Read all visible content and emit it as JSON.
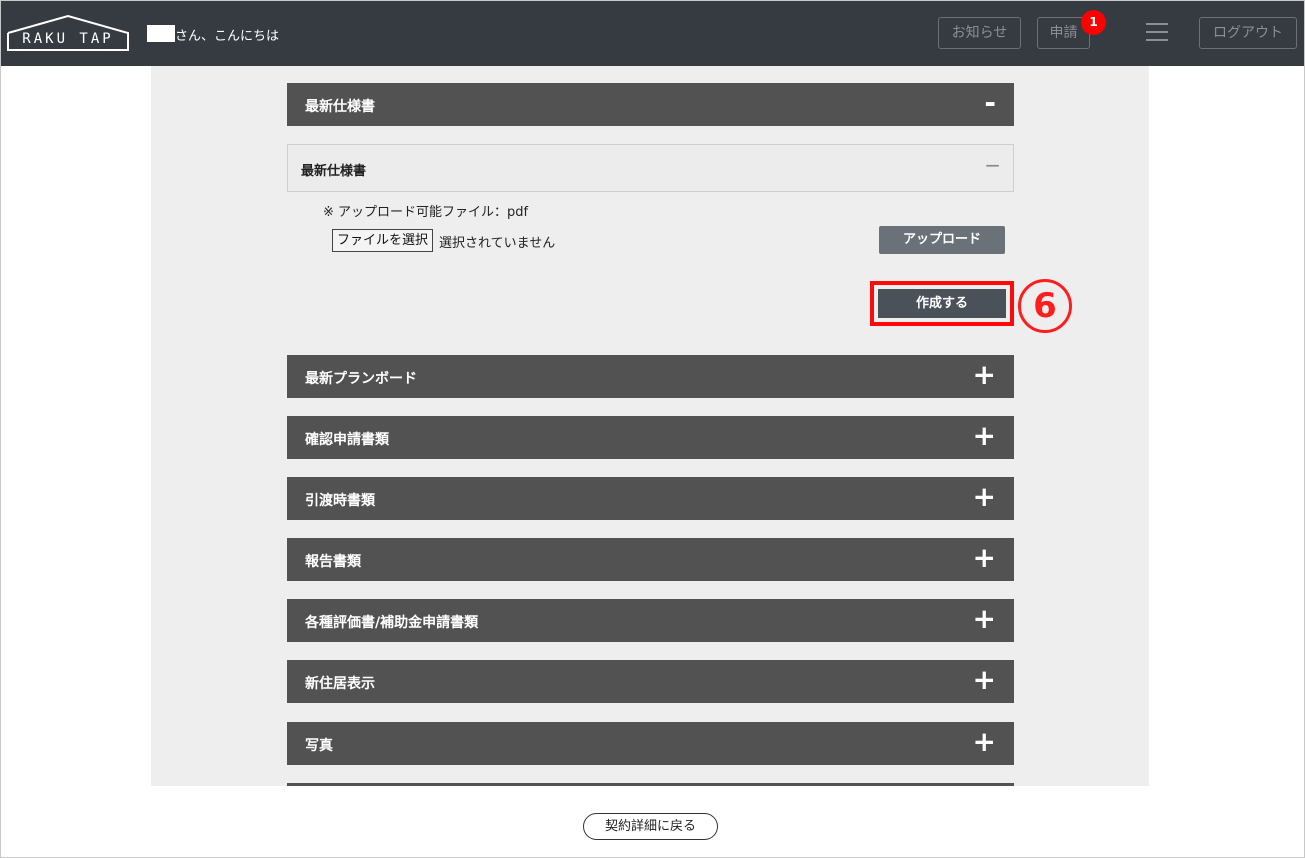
{
  "header": {
    "logo_text": "RAKU TAP",
    "greeting": "さん、こんにちは",
    "notice_label": "お知らせ",
    "apply_label": "申請",
    "apply_badge": "1",
    "logout_label": "ログアウト"
  },
  "spec": {
    "title": "最新仕様書",
    "sign": "-",
    "sub_title": "最新仕様書",
    "sub_sign": "−",
    "note": "※ アップロード可能ファイル：pdf",
    "file_button": "ファイルを選択",
    "file_status": "選択されていません",
    "upload_label": "アップロード",
    "create_label": "作成する",
    "annotation": "6"
  },
  "sections": [
    {
      "title": "最新プランボード",
      "sign": "+"
    },
    {
      "title": "確認申請書類",
      "sign": "+"
    },
    {
      "title": "引渡時書類",
      "sign": "+"
    },
    {
      "title": "報告書類",
      "sign": "+"
    },
    {
      "title": "各種評価書/補助金申請書類",
      "sign": "+"
    },
    {
      "title": "新住居表示",
      "sign": "+"
    },
    {
      "title": "写真",
      "sign": "+"
    }
  ],
  "footer": {
    "back_label": "契約詳細に戻る"
  },
  "colors": {
    "header_bg": "#363a41",
    "accordion_bg": "#525252",
    "highlight": "#ff0a0a",
    "badge": "#ff0000"
  }
}
